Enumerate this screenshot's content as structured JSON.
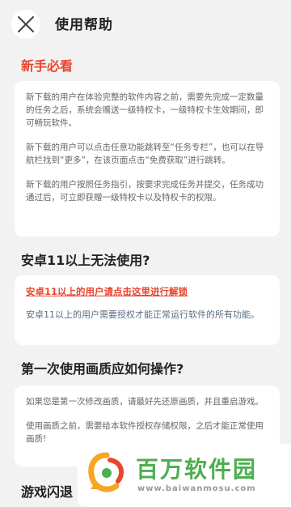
{
  "header": {
    "title": "使用帮助"
  },
  "sections": [
    {
      "title": "新手必看",
      "paragraphs": [
        "新下载的用户在体验完整的软件内容之前，需要先完成一定数量的任务之后，系统会赠送一级特权卡，一级特权卡生效期间，即可畅玩软件。",
        "新下载的用户可以点击任意功能跳转至“任务专栏”，也可以在导航栏找到“更多”，在该页面点击“免费获取”进行跳转。",
        "新下载的用户按照任务指引，按要求完成任务并提交，任务成功通过后，可立即获赠一级特权卡以及特权卡的权限。"
      ]
    },
    {
      "title": "安卓11以上无法使用?",
      "link": "安卓11以上的用户请点击这里进行解锁",
      "note": "安卓11以上的用户需要授权才能正常运行软件的所有功能。"
    },
    {
      "title": "第一次使用画质应如何操作?",
      "paragraphs": [
        "如果您是第一次修改画质，请最好先还原画质，并且重启游戏。",
        "使用画质之前，需要给本软件授权存储权限，之后才能正常使用画质!"
      ]
    },
    {
      "title": "游戏闪退"
    }
  ],
  "watermark": {
    "name": "百万软件园",
    "url": "www.baiwanmosu.com"
  },
  "colors": {
    "accent_red": "#e8462f",
    "watermark_green": "#4caf50",
    "background": "#f2f2f2"
  }
}
